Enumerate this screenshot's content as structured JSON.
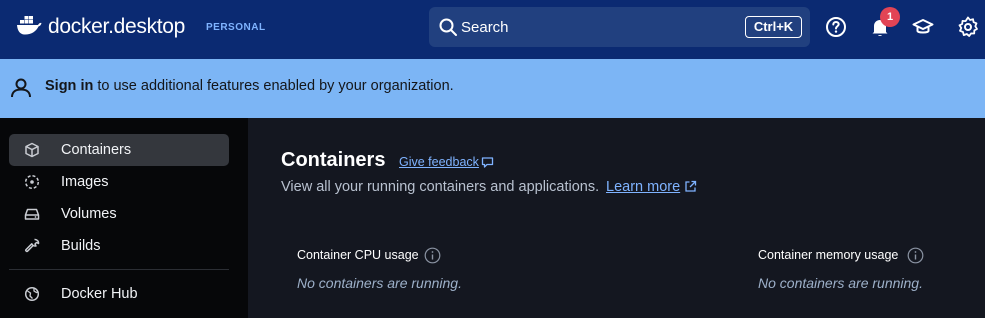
{
  "header": {
    "brand": "docker.desktop",
    "edition": "PERSONAL",
    "search": {
      "label": "Search",
      "shortcut": "Ctrl+K"
    },
    "notifications_count": "1",
    "icons": [
      "help-icon",
      "bell-icon",
      "learning-center-icon",
      "settings-icon"
    ]
  },
  "banner": {
    "link": "Sign in",
    "text": "to use additional features enabled by your organization."
  },
  "sidebar": {
    "items": [
      {
        "label": "Containers",
        "icon": "container-icon",
        "active": true
      },
      {
        "label": "Images",
        "icon": "images-icon",
        "active": false
      },
      {
        "label": "Volumes",
        "icon": "volumes-icon",
        "active": false
      },
      {
        "label": "Builds",
        "icon": "builds-icon",
        "active": false
      },
      {
        "label": "Docker Hub",
        "icon": "docker-hub-icon",
        "active": false
      }
    ]
  },
  "main": {
    "title": "Containers",
    "feedback": "Give feedback",
    "subtitle": "View all your running containers and applications.",
    "learn_more": "Learn more",
    "metrics": [
      {
        "title": "Container CPU usage",
        "empty": "No containers are running."
      },
      {
        "title": "Container memory usage",
        "empty": "No containers are running."
      }
    ]
  },
  "colors": {
    "header_bg": "#0b2a72",
    "banner_bg": "#7cb5f5",
    "link": "#7fb3ff",
    "badge": "#e24455"
  }
}
